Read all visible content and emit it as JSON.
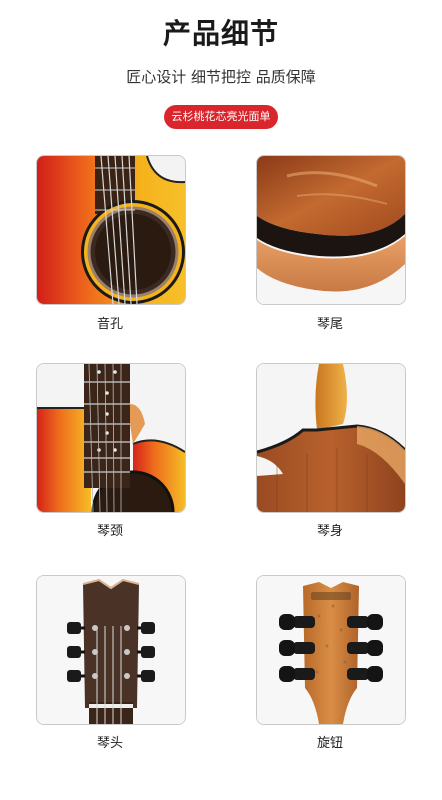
{
  "header": {
    "title": "产品细节",
    "subtitle": "匠心设计 细节把控 品质保障",
    "badge": "云杉桃花芯亮光面单"
  },
  "details": [
    {
      "label": "音孔",
      "icon": "sound-hole-photo"
    },
    {
      "label": "琴尾",
      "icon": "guitar-tail-photo"
    },
    {
      "label": "琴颈",
      "icon": "guitar-neck-photo"
    },
    {
      "label": "琴身",
      "icon": "guitar-body-photo"
    },
    {
      "label": "琴头",
      "icon": "headstock-front-photo"
    },
    {
      "label": "旋钮",
      "icon": "tuning-pegs-photo"
    }
  ],
  "colors": {
    "badge": "#d8262c",
    "sunburst_red": "#d92f1e",
    "sunburst_yellow": "#f4b21c",
    "wood_brown": "#b5632b"
  }
}
